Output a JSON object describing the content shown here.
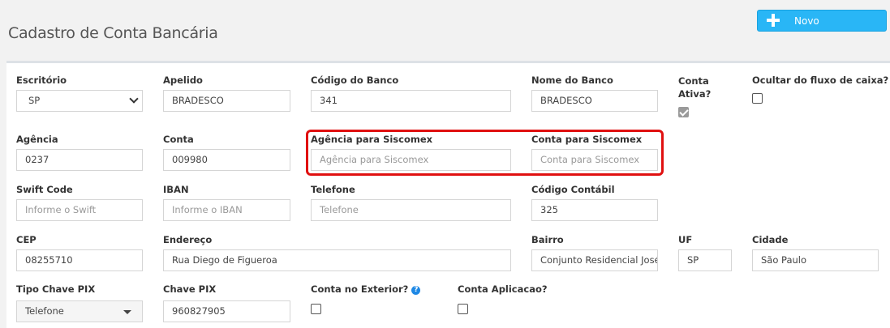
{
  "header": {
    "title": "Cadastro de Conta Bancária",
    "new_label": "Novo"
  },
  "form": {
    "escritorio": {
      "label": "Escritório",
      "value": "SP"
    },
    "apelido": {
      "label": "Apelido",
      "value": "BRADESCO"
    },
    "codigo_banco": {
      "label": "Código do Banco",
      "value": "341"
    },
    "nome_banco": {
      "label": "Nome do Banco",
      "value": "BRADESCO"
    },
    "conta_ativa": {
      "label": "Conta Ativa?",
      "checked": true
    },
    "ocultar_fluxo": {
      "label": "Ocultar do fluxo de caixa?",
      "checked": false
    },
    "agencia": {
      "label": "Agência",
      "value": "0237"
    },
    "conta": {
      "label": "Conta",
      "value": "009980"
    },
    "agencia_siscomex": {
      "label": "Agência para Siscomex",
      "placeholder": "Agência para Siscomex"
    },
    "conta_siscomex": {
      "label": "Conta para Siscomex",
      "placeholder": "Conta para Siscomex"
    },
    "swift": {
      "label": "Swift Code",
      "placeholder": "Informe o Swift"
    },
    "iban": {
      "label": "IBAN",
      "placeholder": "Informe o IBAN"
    },
    "telefone": {
      "label": "Telefone",
      "placeholder": "Telefone"
    },
    "codigo_contabil": {
      "label": "Código Contábil",
      "value": "325"
    },
    "cep": {
      "label": "CEP",
      "value": "08255710"
    },
    "endereco": {
      "label": "Endereço",
      "value": "Rua Diego de Figueroa"
    },
    "bairro": {
      "label": "Bairro",
      "value": "Conjunto Residencial José"
    },
    "uf": {
      "label": "UF",
      "value": "SP"
    },
    "cidade": {
      "label": "Cidade",
      "value": "São Paulo"
    },
    "tipo_chave_pix": {
      "label": "Tipo Chave PIX",
      "value": "Telefone"
    },
    "chave_pix": {
      "label": "Chave PIX",
      "value": "960827905"
    },
    "conta_exterior": {
      "label": "Conta no Exterior?",
      "checked": false
    },
    "conta_aplicacao": {
      "label": "Conta Aplicacao?",
      "checked": false
    }
  },
  "colors": {
    "accent": "#29b6f6",
    "highlight": "#e01010"
  },
  "icons": {
    "new": "plus-icon",
    "help": "question-circle-icon"
  }
}
